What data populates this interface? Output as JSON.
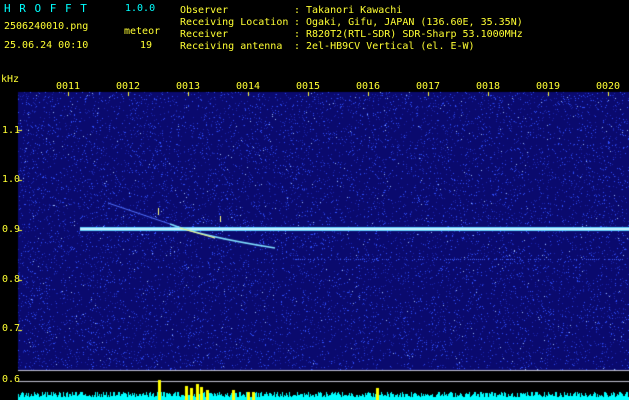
{
  "header": {
    "app_title": "H R O F F T",
    "app_version": "1.0.0",
    "filename": "2506240010.png",
    "mode_label": "meteor",
    "datetime": "25.06.24 00:10",
    "count": "19",
    "observer_label": "Observer",
    "observer_sep": ":",
    "observer_value": "Takanori Kawachi",
    "location_label": "Receiving Location",
    "location_sep": ":",
    "location_value": "Ogaki, Gifu, JAPAN (136.60E, 35.35N)",
    "receiver_label": "Receiver",
    "receiver_sep": ":",
    "receiver_value": "R820T2(RTL-SDR) SDR-Sharp 53.1000MHz",
    "antenna_label": "Receiving antenna",
    "antenna_sep": ":",
    "antenna_value": "2el-HB9CV Vertical (el. E-W)"
  },
  "spectrogram": {
    "unit_label": "kHz",
    "time_ticks": [
      "0011",
      "0012",
      "0013",
      "0014",
      "0015",
      "0016",
      "0017",
      "0018",
      "0019",
      "0020"
    ],
    "freq_ticks": [
      "1.1",
      "1.0",
      "0.9",
      "0.8",
      "0.7",
      "0.6"
    ],
    "colors": {
      "background": "#0a0a6e",
      "noise": "#3050ff",
      "carrier": "#c8f0ff",
      "meteor": "#ffff80",
      "baseline": "#00ffff",
      "peaks": "#ffff00",
      "axis_text": "#ffff33"
    }
  }
}
